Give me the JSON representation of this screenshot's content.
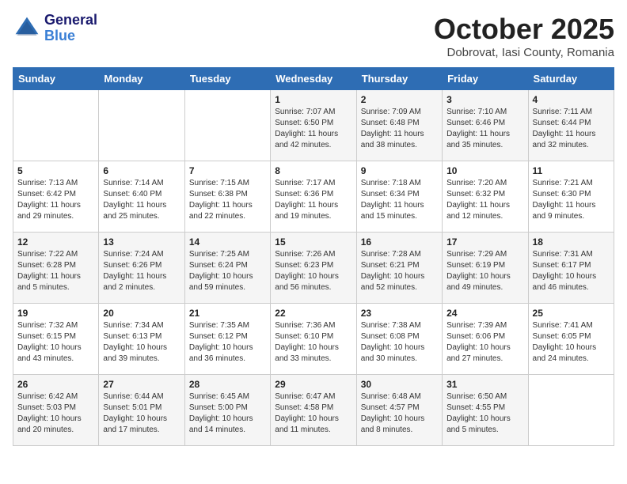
{
  "header": {
    "logo_line1": "General",
    "logo_line2": "Blue",
    "month_title": "October 2025",
    "subtitle": "Dobrovat, Iasi County, Romania"
  },
  "days_of_week": [
    "Sunday",
    "Monday",
    "Tuesday",
    "Wednesday",
    "Thursday",
    "Friday",
    "Saturday"
  ],
  "weeks": [
    [
      {
        "day": "",
        "info": ""
      },
      {
        "day": "",
        "info": ""
      },
      {
        "day": "",
        "info": ""
      },
      {
        "day": "1",
        "info": "Sunrise: 7:07 AM\nSunset: 6:50 PM\nDaylight: 11 hours\nand 42 minutes."
      },
      {
        "day": "2",
        "info": "Sunrise: 7:09 AM\nSunset: 6:48 PM\nDaylight: 11 hours\nand 38 minutes."
      },
      {
        "day": "3",
        "info": "Sunrise: 7:10 AM\nSunset: 6:46 PM\nDaylight: 11 hours\nand 35 minutes."
      },
      {
        "day": "4",
        "info": "Sunrise: 7:11 AM\nSunset: 6:44 PM\nDaylight: 11 hours\nand 32 minutes."
      }
    ],
    [
      {
        "day": "5",
        "info": "Sunrise: 7:13 AM\nSunset: 6:42 PM\nDaylight: 11 hours\nand 29 minutes."
      },
      {
        "day": "6",
        "info": "Sunrise: 7:14 AM\nSunset: 6:40 PM\nDaylight: 11 hours\nand 25 minutes."
      },
      {
        "day": "7",
        "info": "Sunrise: 7:15 AM\nSunset: 6:38 PM\nDaylight: 11 hours\nand 22 minutes."
      },
      {
        "day": "8",
        "info": "Sunrise: 7:17 AM\nSunset: 6:36 PM\nDaylight: 11 hours\nand 19 minutes."
      },
      {
        "day": "9",
        "info": "Sunrise: 7:18 AM\nSunset: 6:34 PM\nDaylight: 11 hours\nand 15 minutes."
      },
      {
        "day": "10",
        "info": "Sunrise: 7:20 AM\nSunset: 6:32 PM\nDaylight: 11 hours\nand 12 minutes."
      },
      {
        "day": "11",
        "info": "Sunrise: 7:21 AM\nSunset: 6:30 PM\nDaylight: 11 hours\nand 9 minutes."
      }
    ],
    [
      {
        "day": "12",
        "info": "Sunrise: 7:22 AM\nSunset: 6:28 PM\nDaylight: 11 hours\nand 5 minutes."
      },
      {
        "day": "13",
        "info": "Sunrise: 7:24 AM\nSunset: 6:26 PM\nDaylight: 11 hours\nand 2 minutes."
      },
      {
        "day": "14",
        "info": "Sunrise: 7:25 AM\nSunset: 6:24 PM\nDaylight: 10 hours\nand 59 minutes."
      },
      {
        "day": "15",
        "info": "Sunrise: 7:26 AM\nSunset: 6:23 PM\nDaylight: 10 hours\nand 56 minutes."
      },
      {
        "day": "16",
        "info": "Sunrise: 7:28 AM\nSunset: 6:21 PM\nDaylight: 10 hours\nand 52 minutes."
      },
      {
        "day": "17",
        "info": "Sunrise: 7:29 AM\nSunset: 6:19 PM\nDaylight: 10 hours\nand 49 minutes."
      },
      {
        "day": "18",
        "info": "Sunrise: 7:31 AM\nSunset: 6:17 PM\nDaylight: 10 hours\nand 46 minutes."
      }
    ],
    [
      {
        "day": "19",
        "info": "Sunrise: 7:32 AM\nSunset: 6:15 PM\nDaylight: 10 hours\nand 43 minutes."
      },
      {
        "day": "20",
        "info": "Sunrise: 7:34 AM\nSunset: 6:13 PM\nDaylight: 10 hours\nand 39 minutes."
      },
      {
        "day": "21",
        "info": "Sunrise: 7:35 AM\nSunset: 6:12 PM\nDaylight: 10 hours\nand 36 minutes."
      },
      {
        "day": "22",
        "info": "Sunrise: 7:36 AM\nSunset: 6:10 PM\nDaylight: 10 hours\nand 33 minutes."
      },
      {
        "day": "23",
        "info": "Sunrise: 7:38 AM\nSunset: 6:08 PM\nDaylight: 10 hours\nand 30 minutes."
      },
      {
        "day": "24",
        "info": "Sunrise: 7:39 AM\nSunset: 6:06 PM\nDaylight: 10 hours\nand 27 minutes."
      },
      {
        "day": "25",
        "info": "Sunrise: 7:41 AM\nSunset: 6:05 PM\nDaylight: 10 hours\nand 24 minutes."
      }
    ],
    [
      {
        "day": "26",
        "info": "Sunrise: 6:42 AM\nSunset: 5:03 PM\nDaylight: 10 hours\nand 20 minutes."
      },
      {
        "day": "27",
        "info": "Sunrise: 6:44 AM\nSunset: 5:01 PM\nDaylight: 10 hours\nand 17 minutes."
      },
      {
        "day": "28",
        "info": "Sunrise: 6:45 AM\nSunset: 5:00 PM\nDaylight: 10 hours\nand 14 minutes."
      },
      {
        "day": "29",
        "info": "Sunrise: 6:47 AM\nSunset: 4:58 PM\nDaylight: 10 hours\nand 11 minutes."
      },
      {
        "day": "30",
        "info": "Sunrise: 6:48 AM\nSunset: 4:57 PM\nDaylight: 10 hours\nand 8 minutes."
      },
      {
        "day": "31",
        "info": "Sunrise: 6:50 AM\nSunset: 4:55 PM\nDaylight: 10 hours\nand 5 minutes."
      },
      {
        "day": "",
        "info": ""
      }
    ]
  ]
}
